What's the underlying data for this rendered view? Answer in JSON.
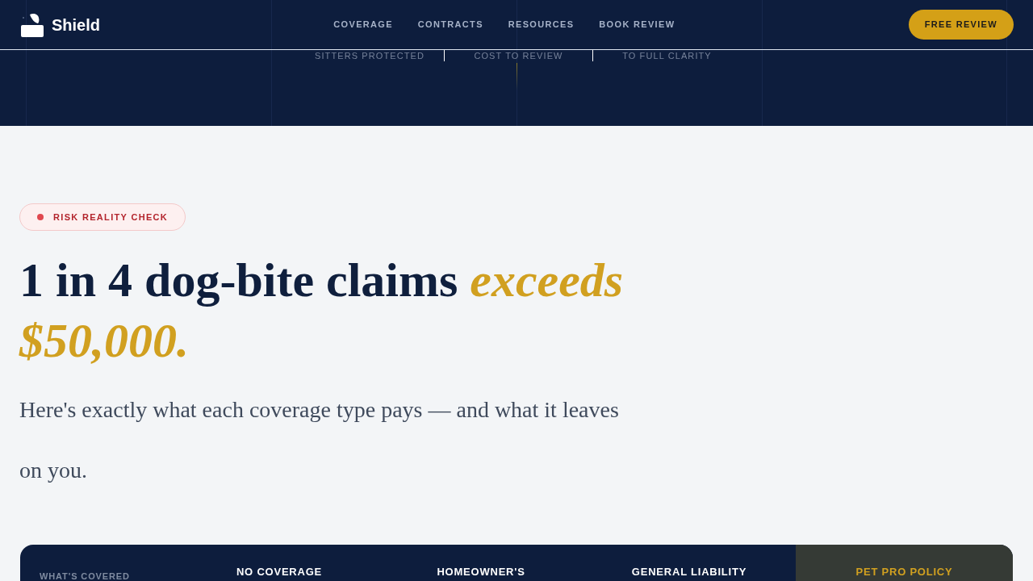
{
  "header": {
    "brand": "Shield",
    "nav": [
      {
        "label": "COVERAGE"
      },
      {
        "label": "CONTRACTS"
      },
      {
        "label": "RESOURCES"
      },
      {
        "label": "BOOK REVIEW"
      }
    ],
    "cta": "FREE REVIEW"
  },
  "hero_stats": [
    {
      "label": "SITTERS PROTECTED"
    },
    {
      "label": "COST TO REVIEW"
    },
    {
      "label": "TO FULL CLARITY"
    }
  ],
  "badge": {
    "label": "RISK REALITY CHECK"
  },
  "headline": "1 in 4 dog-bite claims *exceeds $50,000.*",
  "subtitle": "Here's exactly what each coverage type pays — and what it leaves on you.",
  "comparison_table": {
    "columns": [
      {
        "label": "WHAT'S COVERED",
        "kind": "row_header"
      },
      {
        "label": "NO COVERAGE",
        "kind": "plan"
      },
      {
        "label": "HOMEOWNER'S",
        "kind": "plan"
      },
      {
        "label": "GENERAL LIABILITY",
        "kind": "plan"
      },
      {
        "label": "PET PRO POLICY",
        "kind": "featured"
      }
    ]
  }
}
